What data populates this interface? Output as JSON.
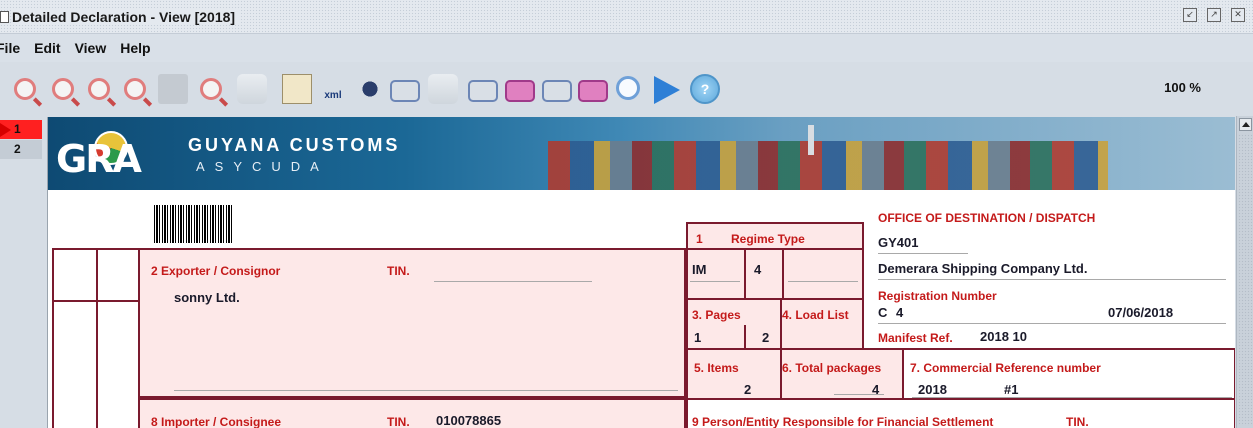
{
  "window": {
    "title": "Detailed Declaration - View [2018]"
  },
  "menu": [
    "File",
    "Edit",
    "View",
    "Help"
  ],
  "toolbar": {
    "zoom": "100 %",
    "xml_label": "xml"
  },
  "pages": [
    "1",
    "2"
  ],
  "banner": {
    "logo_text": "GRA",
    "title": "GUYANA CUSTOMS",
    "subtitle": "ASYCUDA"
  },
  "form": {
    "regime": {
      "number": "1",
      "label": "Regime Type",
      "code": "IM",
      "sub": "4"
    },
    "office": {
      "label": "OFFICE OF DESTINATION / DISPATCH",
      "code": "GY401",
      "carrier": "Demerara Shipping Company Ltd.",
      "reg_label": "Registration Number",
      "reg_prefix": "C",
      "reg_number": "4",
      "reg_date": "07/06/2018",
      "manifest_label": "Manifest Ref.",
      "manifest_value": "2018 10"
    },
    "exporter": {
      "label": "2 Exporter / Consignor",
      "tin_label": "TIN.",
      "name": "sonny Ltd."
    },
    "pages": {
      "label": "3. Pages",
      "current": "1",
      "total": "2"
    },
    "load_list": {
      "label": "4. Load List"
    },
    "items": {
      "label": "5. Items",
      "value": "2"
    },
    "packages": {
      "label": "6. Total packages",
      "value": "4"
    },
    "commercial_ref": {
      "label": "7. Commercial Reference number",
      "year": "2018",
      "number": "#1"
    },
    "importer": {
      "label": "8 Importer / Consignee",
      "tin_label": "TIN.",
      "tin": "010078865"
    },
    "financial": {
      "label": "9 Person/Entity Responsible for Financial Settlement",
      "tin_label": "TIN."
    }
  }
}
